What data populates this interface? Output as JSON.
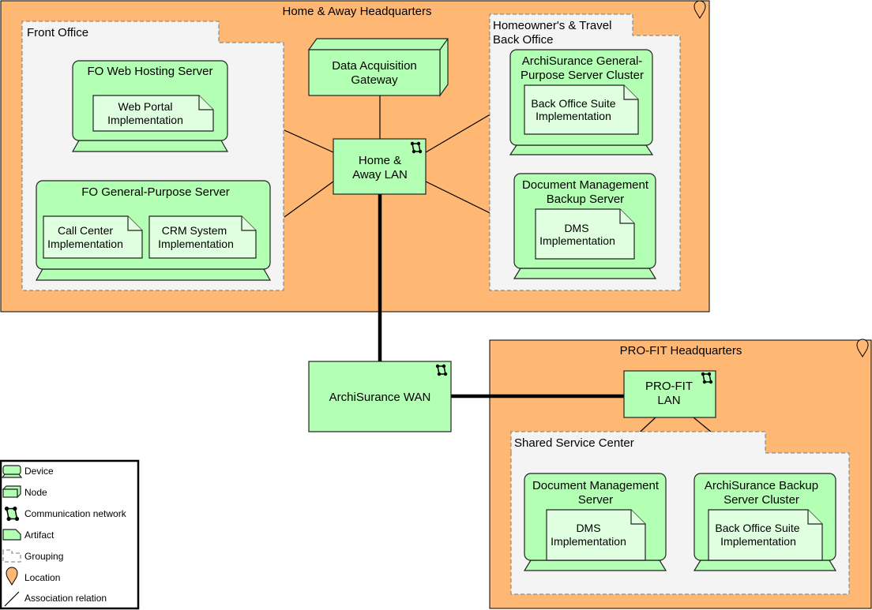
{
  "colors": {
    "location": "#ffb874",
    "technology": "#b3ffb3",
    "artifact": "#e0ffe0",
    "grouping": "#f4f4f4"
  },
  "locations": {
    "home_away": {
      "title": "Home & Away Headquarters",
      "icon": "location-pin-icon"
    },
    "profit": {
      "title": "PRO-FIT Headquarters",
      "icon": "location-pin-icon"
    }
  },
  "groups": {
    "front_office": "Front Office",
    "back_office": [
      "Homeowner's & Travel",
      "Back Office"
    ],
    "shared_service": "Shared Service Center"
  },
  "devices": {
    "fo_web": {
      "name": "FO Web Hosting Server",
      "artifact": [
        "Web Portal",
        "Implementation"
      ]
    },
    "fo_gp": {
      "name": "FO General-Purpose Server",
      "artifacts": [
        [
          "Call Center",
          "Implementation"
        ],
        [
          "CRM System",
          "Implementation"
        ]
      ]
    },
    "as_cluster": {
      "name": [
        "ArchiSurance General-",
        "Purpose Server Cluster"
      ],
      "artifact": [
        "Back Office Suite",
        "Implementation"
      ]
    },
    "dm_backup": {
      "name": [
        "Document Management",
        "Backup Server"
      ],
      "artifact": [
        "DMS",
        "Implementation"
      ]
    },
    "dm_server": {
      "name": [
        "Document Management",
        "Server"
      ],
      "artifact": [
        "DMS",
        "Implementation"
      ]
    },
    "as_backup": {
      "name": [
        "ArchiSurance Backup",
        "Server Cluster"
      ],
      "artifact": [
        "Back Office Suite",
        "Implementation"
      ]
    }
  },
  "nodes": {
    "gateway": [
      "Data Acquisition",
      "Gateway"
    ]
  },
  "networks": {
    "ha_lan": [
      "Home &",
      "Away LAN"
    ],
    "wan": "ArchiSurance WAN",
    "profit_lan": [
      "PRO-FIT",
      "LAN"
    ]
  },
  "legend": {
    "items": [
      "Device",
      "Node",
      "Communication network",
      "Artifact",
      "Grouping",
      "Location",
      "Association relation"
    ]
  }
}
